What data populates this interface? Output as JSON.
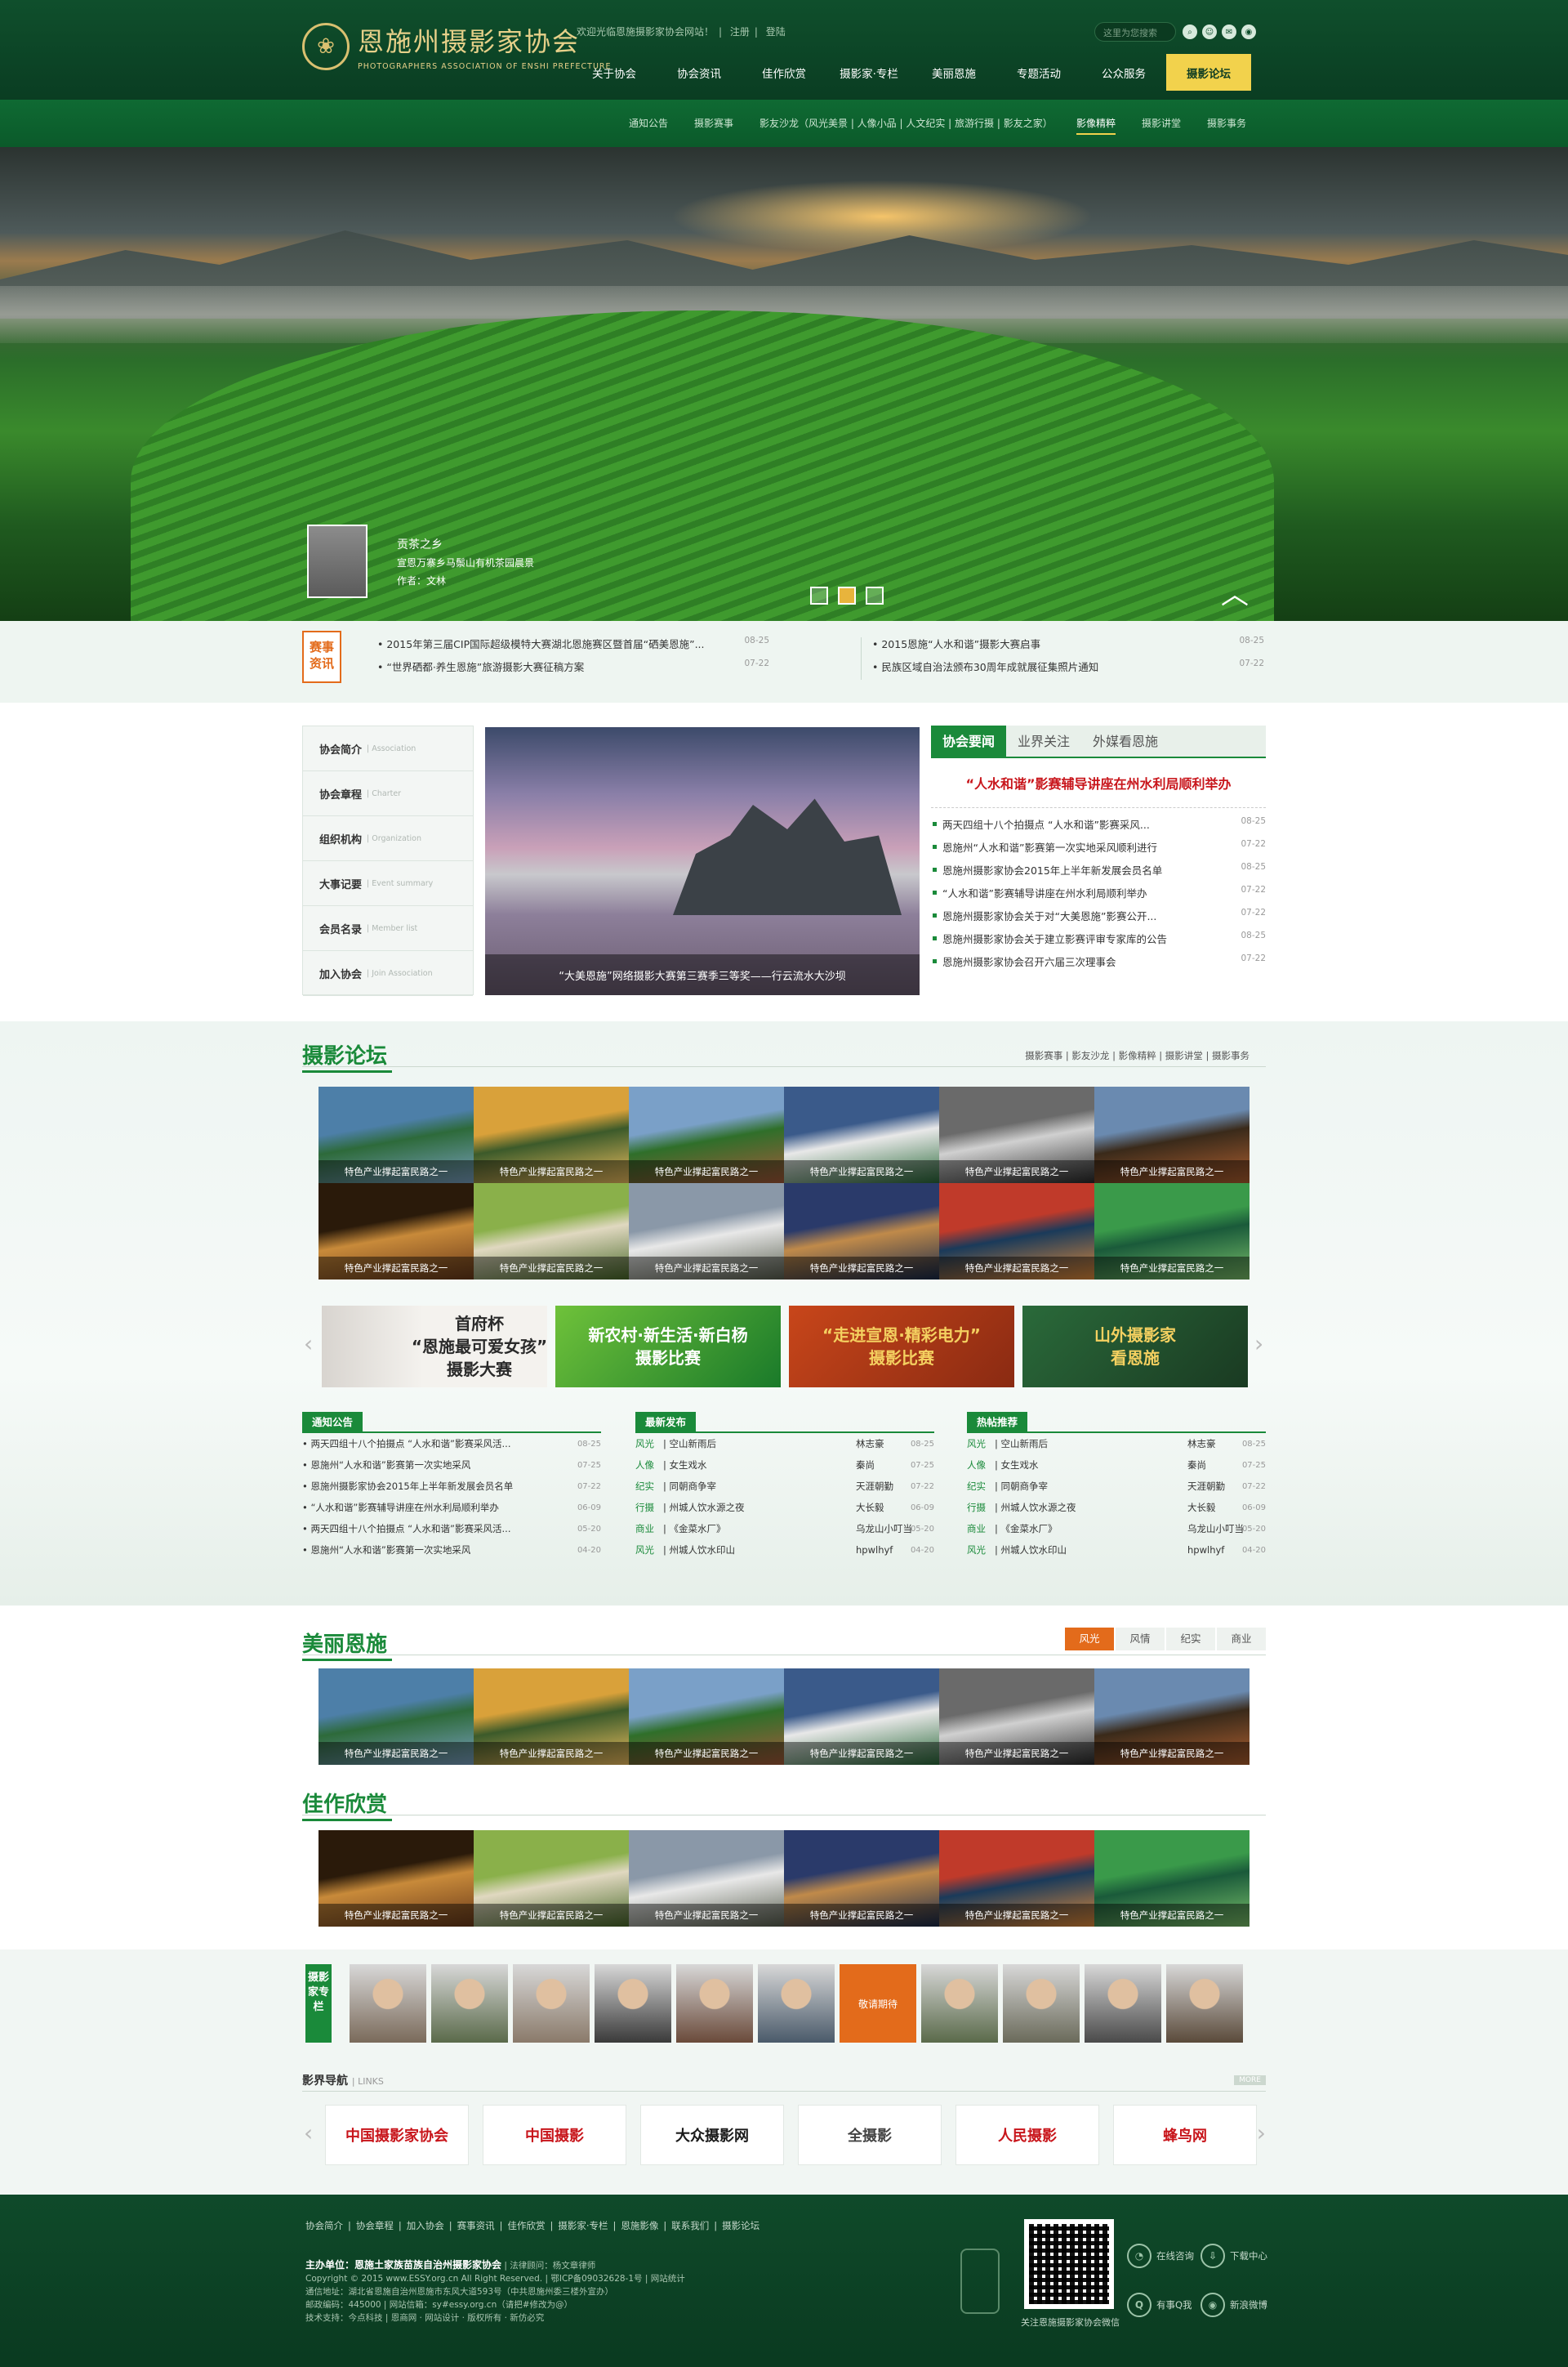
{
  "header": {
    "logo_cn": "恩施州摄影家协会",
    "logo_en": "PHOTOGRAPHERS ASSOCIATION OF ENSHI PREFECTURE",
    "welcome": "欢迎光临恩施摄影家协会网站！",
    "register": "注册",
    "login": "登陆",
    "search_placeholder": "这里为您搜索",
    "nav": [
      "关于协会",
      "协会资讯",
      "佳作欣赏",
      "摄影家·专栏",
      "美丽恩施",
      "专题活动",
      "公众服务",
      "摄影论坛"
    ],
    "active_nav": "摄影论坛",
    "subnav": [
      "通知公告",
      "摄影赛事",
      "影友沙龙（风光美景 | 人像小品 | 人文纪实 | 旅游行摄 | 影友之家）",
      "影像精粹",
      "摄影讲堂",
      "摄影事务"
    ],
    "active_sub": "影像精粹"
  },
  "hero": {
    "title": "贡茶之乡",
    "desc": "宣恩万寨乡马鬃山有机茶园晨景",
    "author": "作者：文林"
  },
  "ticker": {
    "badge": "赛事资讯",
    "left": [
      {
        "t": "2015年第三届CIP国际超级模特大赛湖北恩施赛区暨首届“硒美恩施”...",
        "d": "08-25"
      },
      {
        "t": "“世界硒都·养生恩施”旅游摄影大赛征稿方案",
        "d": "07-22"
      }
    ],
    "right": [
      {
        "t": "2015恩施“人水和谐”摄影大赛启事",
        "d": "08-25"
      },
      {
        "t": "民族区域自治法颁布30周年成就展征集照片通知",
        "d": "07-22"
      }
    ]
  },
  "about": {
    "menu": [
      {
        "cn": "协会简介",
        "en": "Association"
      },
      {
        "cn": "协会章程",
        "en": "Charter"
      },
      {
        "cn": "组织机构",
        "en": "Organization"
      },
      {
        "cn": "大事记要",
        "en": "Event summary"
      },
      {
        "cn": "会员名录",
        "en": "Member list"
      },
      {
        "cn": "加入协会",
        "en": "Join Association"
      }
    ],
    "pic_caption": "“大美恩施”网络摄影大赛第三赛季三等奖——行云流水大沙坝",
    "tabs": [
      "协会要闻",
      "业界关注",
      "外媒看恩施"
    ],
    "headline": "“人水和谐”影赛辅导讲座在州水利局顺利举办",
    "news": [
      {
        "t": "两天四组十八个拍摄点 “人水和谐”影赛采风...",
        "d": "08-25"
      },
      {
        "t": "恩施州“人水和谐”影赛第一次实地采风顺利进行",
        "d": "07-22"
      },
      {
        "t": "恩施州摄影家协会2015年上半年新发展会员名单",
        "d": "08-25"
      },
      {
        "t": "“人水和谐”影赛辅导讲座在州水利局顺利举办",
        "d": "07-22"
      },
      {
        "t": "恩施州摄影家协会关于对“大美恩施”影赛公开...",
        "d": "07-22"
      },
      {
        "t": "恩施州摄影家协会关于建立影赛评审专家库的公告",
        "d": "08-25"
      },
      {
        "t": "恩施州摄影家协会召开六届三次理事会",
        "d": "07-22"
      }
    ]
  },
  "forum": {
    "title": "摄影论坛",
    "links": "摄影赛事 | 影友沙龙 | 影像精粹 | 摄影讲堂 | 摄影事务",
    "caption": "特色产业撑起富民路之一",
    "banners": [
      {
        "line1": "首府杯",
        "line2": "“恩施最可爱女孩”",
        "line3": "摄影大赛"
      },
      {
        "line1": "新农村·新生活·新白杨",
        "line2": "摄影比赛",
        "line3": ""
      },
      {
        "line1": "“走进宣恩·精彩电力”",
        "line2": "摄影比赛",
        "line3": ""
      },
      {
        "line1": "山外摄影家",
        "line2": "看恩施",
        "line3": ""
      }
    ]
  },
  "lists": {
    "notice": {
      "title": "通知公告",
      "rows": [
        {
          "t": "两天四组十八个拍摄点 “人水和谐”影赛采风活...",
          "d": "08-25"
        },
        {
          "t": "恩施州“人水和谐”影赛第一次实地采风",
          "d": "07-25"
        },
        {
          "t": "恩施州摄影家协会2015年上半年新发展会员名单",
          "d": "07-22"
        },
        {
          "t": "“人水和谐”影赛辅导讲座在州水利局顺利举办",
          "d": "06-09"
        },
        {
          "t": "两天四组十八个拍摄点 “人水和谐”影赛采风活...",
          "d": "05-20"
        },
        {
          "t": "恩施州“人水和谐”影赛第一次实地采风",
          "d": "04-20"
        }
      ]
    },
    "latest": {
      "title": "最新发布",
      "rows": [
        {
          "k": "风光",
          "t": "空山新雨后",
          "a": "林志豪",
          "d": "08-25"
        },
        {
          "k": "人像",
          "t": "女生戏水",
          "a": "秦尚",
          "d": "07-25"
        },
        {
          "k": "纪实",
          "t": "同朝商争宰",
          "a": "天涯朝勤",
          "d": "07-22"
        },
        {
          "k": "行摄",
          "t": "州城人饮水源之夜",
          "a": "大长毅",
          "d": "06-09"
        },
        {
          "k": "商业",
          "t": "《金菜水厂》",
          "a": "乌龙山小叮当",
          "d": "05-20"
        },
        {
          "k": "风光",
          "t": "州城人饮水印山",
          "a": "hpwlhyf",
          "d": "04-20"
        }
      ]
    },
    "hot": {
      "title": "热帖推荐",
      "rows": [
        {
          "k": "风光",
          "t": "空山新雨后",
          "a": "林志豪",
          "d": "08-25"
        },
        {
          "k": "人像",
          "t": "女生戏水",
          "a": "秦尚",
          "d": "07-25"
        },
        {
          "k": "纪实",
          "t": "同朝商争宰",
          "a": "天涯朝勤",
          "d": "07-22"
        },
        {
          "k": "行摄",
          "t": "州城人饮水源之夜",
          "a": "大长毅",
          "d": "06-09"
        },
        {
          "k": "商业",
          "t": "《金菜水厂》",
          "a": "乌龙山小叮当",
          "d": "05-20"
        },
        {
          "k": "风光",
          "t": "州城人饮水印山",
          "a": "hpwlhyf",
          "d": "04-20"
        }
      ]
    }
  },
  "beauty": {
    "title": "美丽恩施",
    "tabs": [
      "风光",
      "风情",
      "纪实",
      "商业"
    ],
    "active": "风光"
  },
  "works": {
    "title": "佳作欣赏"
  },
  "photographers": {
    "label": "摄影家专栏",
    "orange_text": "敬请期待"
  },
  "links": {
    "title": "影界导航",
    "sub": "| LINKS",
    "more": "MORE",
    "items": [
      "中国摄影家协会",
      "中国摄影",
      "大众摄影网",
      "全摄影",
      "人民摄影",
      "蜂鸟网"
    ]
  },
  "footer": {
    "links": [
      "协会简介",
      "协会章程",
      "加入协会",
      "赛事资讯",
      "佳作欣赏",
      "摄影家·专栏",
      "恩施影像",
      "联系我们",
      "摄影论坛"
    ],
    "host": "主办单位：恩施土家族苗族自治州摄影家协会",
    "legal": "法律顾问：杨文章律师",
    "copyright": "Copyright © 2015 www.ESSY.org.cn All Right Reserved. | 鄂ICP备09032628-1号 | 网站统计",
    "address": "通信地址：湖北省恩施自治州恩施市东风大道593号（中共恩施州委三楼外宣办）",
    "postcode": "邮政编码：445000 | 网站信箱：sy#essy.org.cn（请把#修改为@）",
    "support": "技术支持：今点科技 | 恩商网 · 网站设计 · 版权所有 · 新仿必究",
    "qr_caption": "关注恩施摄影家协会微信",
    "icons": [
      {
        "name": "在线咨询",
        "ic": "◔"
      },
      {
        "name": "下载中心",
        "ic": "⇩"
      },
      {
        "name": "有事Q我",
        "ic": "Q"
      },
      {
        "name": "新浪微博",
        "ic": "◉"
      }
    ]
  },
  "colors": {
    "brand_green": "#1a8a3a",
    "header_green": "#0f4f2c",
    "accent_yellow": "#f2d24c",
    "orange": "#e36b1b",
    "headline_red": "#c8151b"
  }
}
